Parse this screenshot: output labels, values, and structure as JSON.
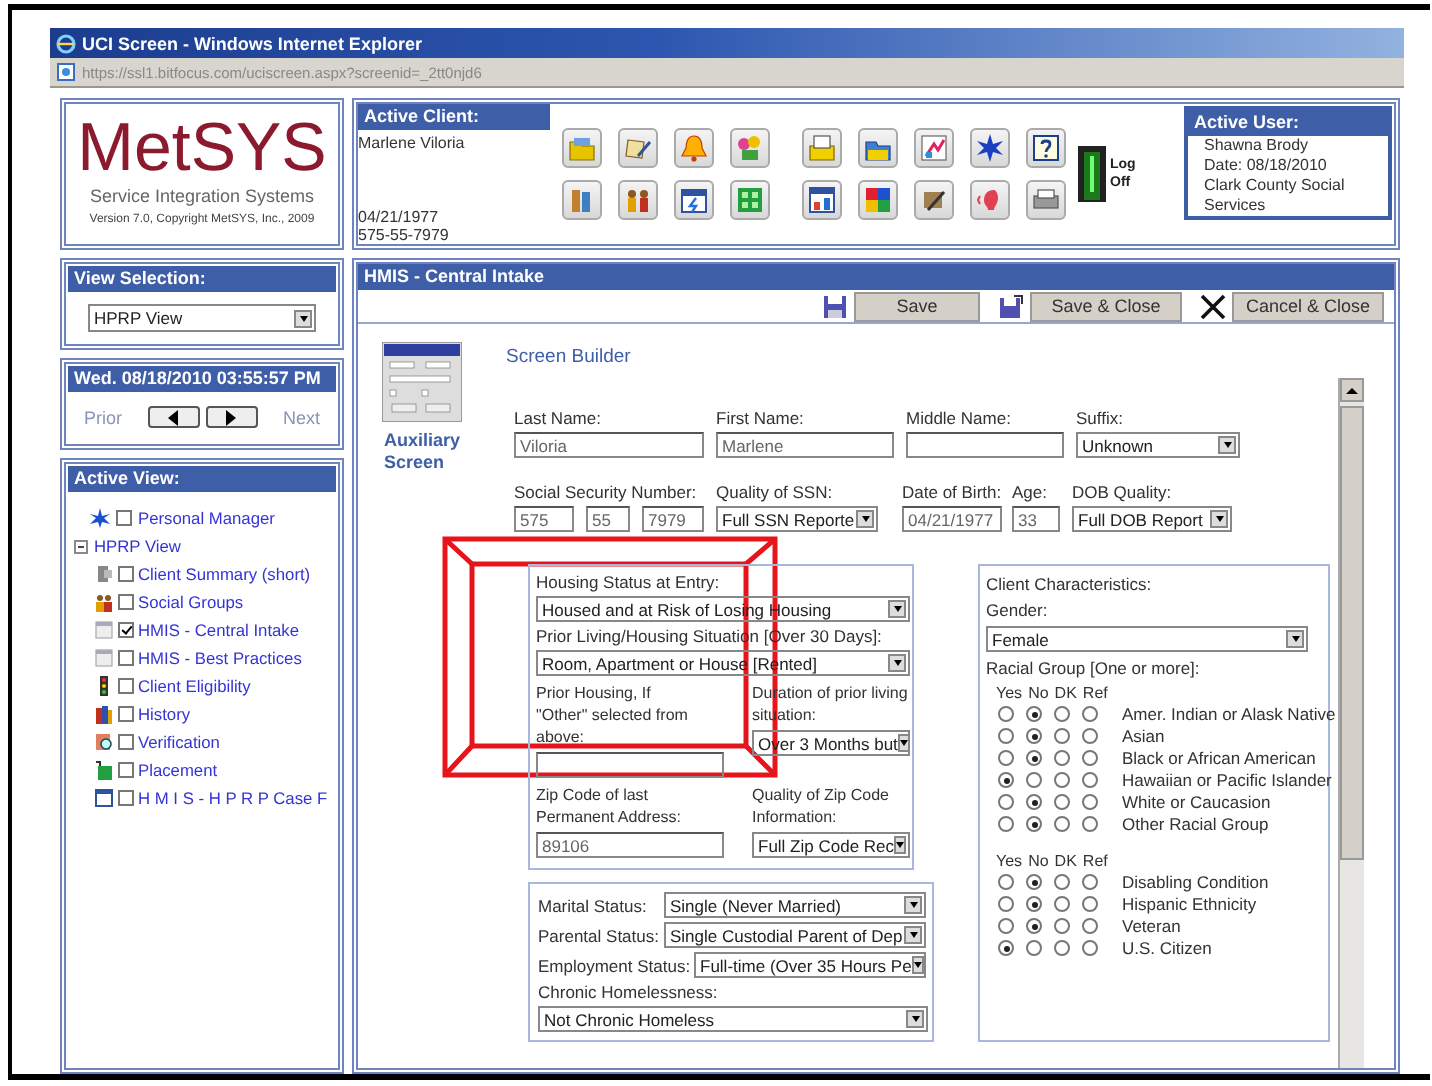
{
  "window": {
    "title": "UCI Screen - Windows Internet Explorer",
    "address": "https://ssl1.bitfocus.com/uciscreen.aspx?screenid=_2tt0njd6"
  },
  "logo": {
    "title": "MetSYS",
    "subtitle": "Service Integration Systems",
    "version": "Version 7.0, Copyright MetSYS, Inc., 2009"
  },
  "active_client": {
    "heading": "Active Client:",
    "name": "Marlene Viloria",
    "dob": "04/21/1977",
    "ssn": "575-55-7979"
  },
  "log_off": "Log Off",
  "active_user": {
    "heading": "Active User:",
    "lines": [
      "Shawna Brody",
      "Date: 08/18/2010",
      "Clark County Social Services"
    ]
  },
  "view_selection": {
    "heading": "View Selection:",
    "value": "HPRP View"
  },
  "date_nav": {
    "heading": "Wed. 08/18/2010 03:55:57 PM",
    "prior": "Prior",
    "next": "Next"
  },
  "active_view": {
    "heading": "Active View:",
    "items": [
      {
        "label": "Personal Manager",
        "checked": false
      },
      {
        "label": "HPRP View",
        "expanded": true,
        "children": [
          {
            "label": "Client Summary (short)",
            "checked": false
          },
          {
            "label": "Social Groups",
            "checked": false
          },
          {
            "label": "HMIS - Central Intake",
            "checked": true
          },
          {
            "label": "HMIS - Best Practices",
            "checked": false
          },
          {
            "label": "Client Eligibility",
            "checked": false
          },
          {
            "label": "History",
            "checked": false
          },
          {
            "label": "Verification",
            "checked": false
          },
          {
            "label": "Placement",
            "checked": false
          },
          {
            "label": "H M I S - H P R P Case F",
            "checked": false
          }
        ]
      }
    ]
  },
  "main": {
    "title": "HMIS - Central Intake",
    "buttons": [
      "Save",
      "Save & Close",
      "Cancel & Close"
    ],
    "aux_label": "Auxiliary Screen",
    "heading": "Screen Builder"
  },
  "name_row": [
    {
      "kind": "text",
      "label": "Last Name:",
      "value": "Viloria"
    },
    {
      "kind": "text",
      "label": "First Name:",
      "value": "Marlene"
    },
    {
      "kind": "text",
      "label": "Middle Name:"
    },
    {
      "kind": "select",
      "label": "Suffix:",
      "value": "Unknown"
    }
  ],
  "id_row": [
    {
      "kind": "ssn",
      "label": "Social Security Number:",
      "parts": [
        "575",
        "55",
        "7979"
      ]
    },
    {
      "kind": "select",
      "label": "Quality of SSN:",
      "value": "Full SSN Reporte"
    },
    {
      "kind": "text",
      "label": "Date of Birth:",
      "value": "04/21/1977"
    },
    {
      "kind": "text",
      "label": "Age:",
      "value": "33"
    },
    {
      "kind": "select",
      "label": "DOB Quality:",
      "value": "Full DOB Report"
    }
  ],
  "housing": [
    {
      "kind": "select",
      "label": "Housing Status at Entry:",
      "value": "Housed and at Risk of Losing Housing"
    },
    {
      "kind": "select",
      "label": "Prior Living/Housing Situation [Over 30 Days]:",
      "value": "Room, Apartment or House [Rented]"
    },
    {
      "kind": "text",
      "label": "Prior Housing, If \"Other\" selected from above:"
    },
    {
      "kind": "select",
      "label": "Duration of prior living situation:",
      "value": "Over 3 Months but"
    },
    {
      "kind": "text",
      "label": "Zip Code of last Permanent Address:",
      "value": "89106"
    },
    {
      "kind": "select",
      "label": "Quality of Zip Code Information:",
      "value": "Full Zip Code Rec"
    }
  ],
  "status": [
    {
      "kind": "inline",
      "label": "Marital Status:",
      "value": "Single (Never Married)"
    },
    {
      "kind": "inline",
      "label": "Parental Status:",
      "value": "Single Custodial Parent of Dep"
    },
    {
      "kind": "inline",
      "label": "Employment Status:",
      "value": "Full-time (Over 35 Hours Pe"
    },
    {
      "kind": "stacked",
      "label": "Chronic Homelessness:",
      "value": "Not Chronic Homeless"
    }
  ],
  "client": {
    "heading": "Client Characteristics:",
    "gender_label": "Gender:",
    "gender": "Female",
    "race_label": "Racial Group [One or more]:",
    "groups": [
      {
        "columns": [
          "Yes",
          "No",
          "DK",
          "Ref"
        ],
        "rows": [
          {
            "label": "Amer. Indian or Alask Native",
            "options": [
              {
                "selected": false
              },
              {
                "selected": true
              },
              {
                "selected": false
              },
              {
                "selected": false
              }
            ]
          },
          {
            "label": "Asian",
            "options": [
              {
                "selected": false
              },
              {
                "selected": true
              },
              {
                "selected": false
              },
              {
                "selected": false
              }
            ]
          },
          {
            "label": "Black or African American",
            "options": [
              {
                "selected": false
              },
              {
                "selected": true
              },
              {
                "selected": false
              },
              {
                "selected": false
              }
            ]
          },
          {
            "label": "Hawaiian or Pacific Islander",
            "options": [
              {
                "selected": true
              },
              {
                "selected": false
              },
              {
                "selected": false
              },
              {
                "selected": false
              }
            ]
          },
          {
            "label": "White or Caucasion",
            "options": [
              {
                "selected": false
              },
              {
                "selected": true
              },
              {
                "selected": false
              },
              {
                "selected": false
              }
            ]
          },
          {
            "label": "Other Racial Group",
            "options": [
              {
                "selected": false
              },
              {
                "selected": true
              },
              {
                "selected": false
              },
              {
                "selected": false
              }
            ]
          }
        ]
      },
      {
        "columns": [
          "Yes",
          "No",
          "DK",
          "Ref"
        ],
        "rows": [
          {
            "label": "Disabling Condition",
            "options": [
              {
                "selected": false
              },
              {
                "selected": true
              },
              {
                "selected": false
              },
              {
                "selected": false
              }
            ]
          },
          {
            "label": "Hispanic Ethnicity",
            "options": [
              {
                "selected": false
              },
              {
                "selected": true
              },
              {
                "selected": false
              },
              {
                "selected": false
              }
            ]
          },
          {
            "label": "Veteran",
            "options": [
              {
                "selected": false
              },
              {
                "selected": true
              },
              {
                "selected": false
              },
              {
                "selected": false
              }
            ]
          },
          {
            "label": "U.S. Citizen",
            "options": [
              {
                "selected": true
              },
              {
                "selected": false
              },
              {
                "selected": false
              },
              {
                "selected": false
              }
            ]
          }
        ]
      }
    ]
  }
}
